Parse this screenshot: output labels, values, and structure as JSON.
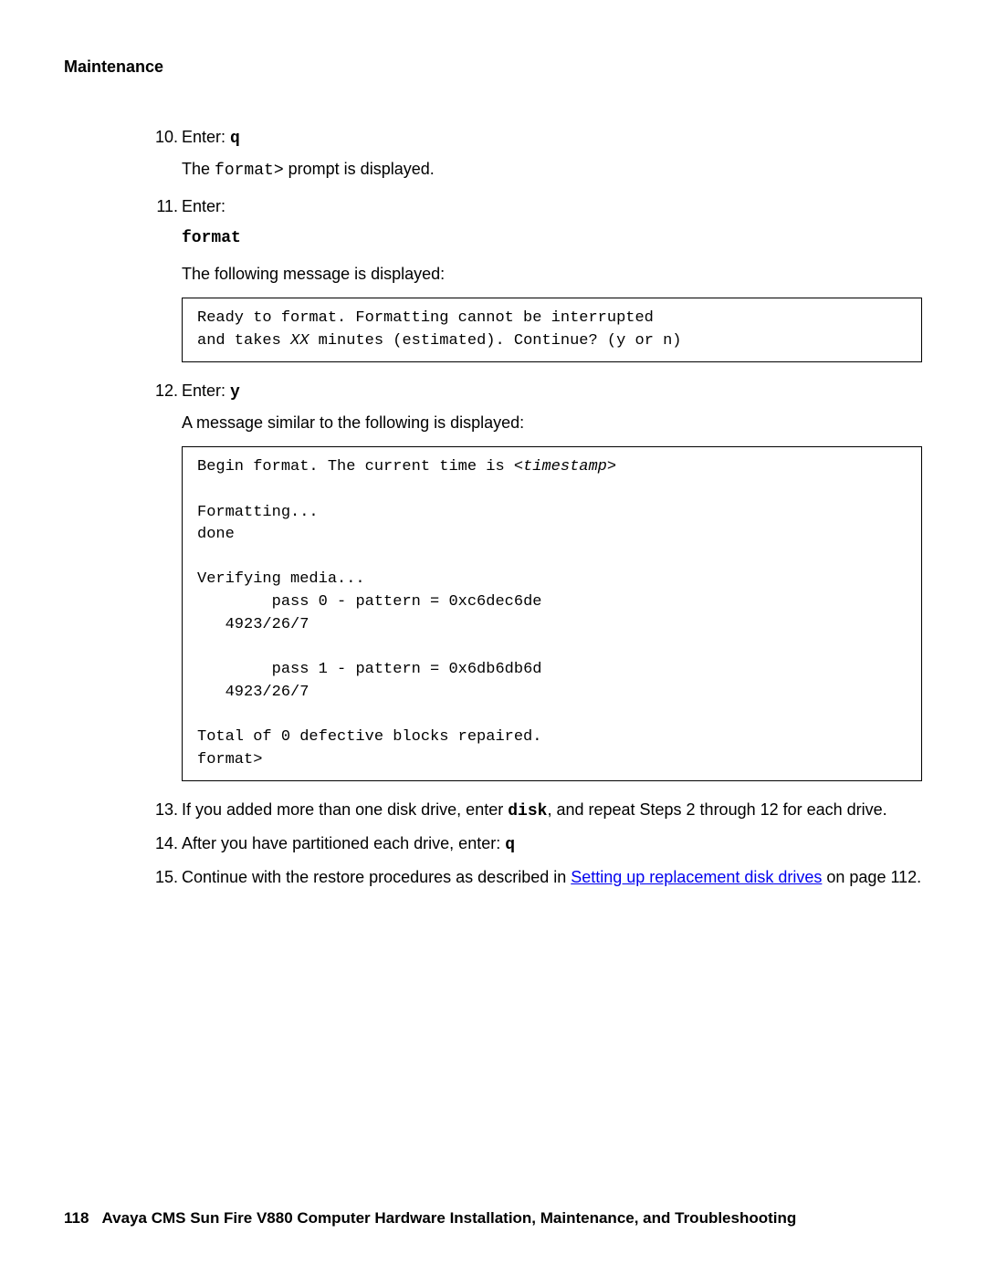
{
  "header": {
    "section": "Maintenance"
  },
  "steps": {
    "s10": {
      "num": "10.",
      "text_pre": "Enter: ",
      "cmd": "q",
      "sub_pre": "The ",
      "sub_mono": "format>",
      "sub_post": " prompt is displayed."
    },
    "s11": {
      "num": "11.",
      "text": "Enter:",
      "cmd": "format",
      "sub": "The following message is displayed:",
      "block_line1": "Ready to format. Formatting cannot be interrupted",
      "block_line2a": "and takes ",
      "block_line2b": "XX",
      "block_line2c": " minutes (estimated). Continue? (y or n)"
    },
    "s12": {
      "num": "12.",
      "text_pre": "Enter: ",
      "cmd": "y",
      "sub": "A message similar to the following is displayed:",
      "block_l1a": "Begin format. The current time is ",
      "block_l1b": "<timestamp>",
      "block_l2": "",
      "block_l3": "Formatting...",
      "block_l4": "done",
      "block_l5": "",
      "block_l6": "Verifying media...",
      "block_l7": "        pass 0 - pattern = 0xc6dec6de",
      "block_l8": "   4923/26/7",
      "block_l9": "",
      "block_l10": "        pass 1 - pattern = 0x6db6db6d",
      "block_l11": "   4923/26/7",
      "block_l12": "",
      "block_l13": "Total of 0 defective blocks repaired.",
      "block_l14": "format>"
    },
    "s13": {
      "num": "13.",
      "text_pre": "If you added more than one disk drive, enter ",
      "cmd": "disk",
      "text_post": ", and repeat Steps 2 through 12 for each drive."
    },
    "s14": {
      "num": "14.",
      "text_pre": "After you have partitioned each drive, enter: ",
      "cmd": "q"
    },
    "s15": {
      "num": "15.",
      "text_pre": "Continue with the restore procedures as described in ",
      "link": "Setting up replacement disk drives",
      "text_post": " on page 112."
    }
  },
  "footer": {
    "page": "118",
    "title": "Avaya CMS Sun Fire V880 Computer Hardware Installation, Maintenance, and Troubleshooting"
  }
}
